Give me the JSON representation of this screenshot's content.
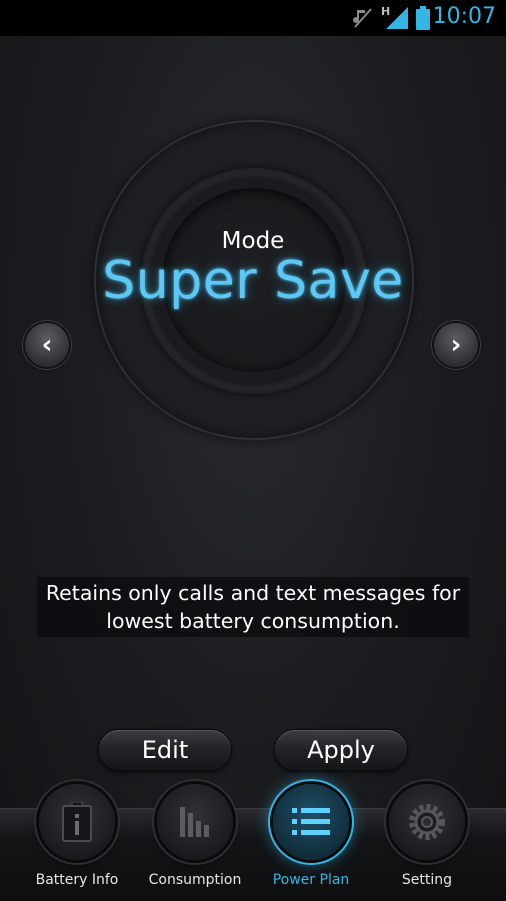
{
  "status_bar": {
    "time": "10:07",
    "network_type": "H",
    "accent_color": "#33b5e5",
    "icons": [
      "mute-icon",
      "signal-icon",
      "battery-icon"
    ]
  },
  "dial": {
    "mode_label": "Mode",
    "mode_name": "Super Save",
    "prev_icon": "‹",
    "next_icon": "›"
  },
  "description": "Retains only calls and text messages for lowest battery consumption.",
  "actions": {
    "edit_label": "Edit",
    "apply_label": "Apply"
  },
  "nav": {
    "items": [
      {
        "label": "Battery Info",
        "icon": "battery-info-icon",
        "active": false
      },
      {
        "label": "Consumption",
        "icon": "bar-chart-icon",
        "active": false
      },
      {
        "label": "Power Plan",
        "icon": "list-icon",
        "active": true
      },
      {
        "label": "Setting",
        "icon": "gear-icon",
        "active": false
      }
    ]
  }
}
